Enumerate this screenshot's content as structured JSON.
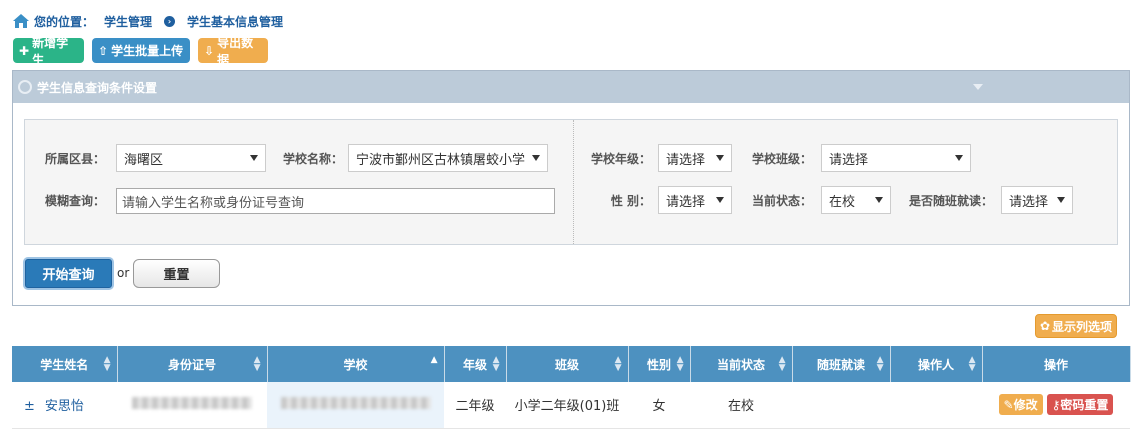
{
  "breadcrumb": {
    "prefix": "您的位置：",
    "level1": "学生管理",
    "level2": "学生基本信息管理"
  },
  "toolbar": {
    "add": "新增学生",
    "upload": "学生批量上传",
    "export": "导出数据"
  },
  "panel": {
    "title": "学生信息查询条件设置"
  },
  "filters": {
    "district_label": "所属区县：",
    "district_value": "海曙区",
    "school_label": "学校名称：",
    "school_value": "宁波市鄞州区古林镇屠蛟小学",
    "fuzzy_label": "模糊查询：",
    "fuzzy_placeholder": "请输入学生名称或身份证号查询",
    "grade_label": "学校年级：",
    "grade_value": "请选择",
    "class_label": "学校班级：",
    "class_value": "请选择",
    "gender_label": "性 别：",
    "gender_value": "请选择",
    "status_label": "当前状态：",
    "status_value": "在校",
    "follow_label": "是否随班就读：",
    "follow_value": "请选择"
  },
  "actions": {
    "query": "开始查询",
    "or": "or",
    "reset": "重置"
  },
  "column_options": "显示列选项",
  "table": {
    "headers": [
      "学生姓名",
      "身份证号",
      "学校",
      "年级",
      "班级",
      "性别",
      "当前状态",
      "随班就读",
      "操作人",
      "操作"
    ],
    "rows": [
      {
        "name": "安思怡",
        "grade": "二年级",
        "class": "小学二年级(01)班",
        "gender": "女",
        "status": "在校",
        "follow": "",
        "operator": "",
        "edit": "修改",
        "pwd_reset": "密码重置"
      }
    ]
  },
  "colors": {
    "accent": "#4d91c0",
    "green": "#2bb488",
    "orange": "#f0ad4e",
    "red": "#d9534f"
  }
}
